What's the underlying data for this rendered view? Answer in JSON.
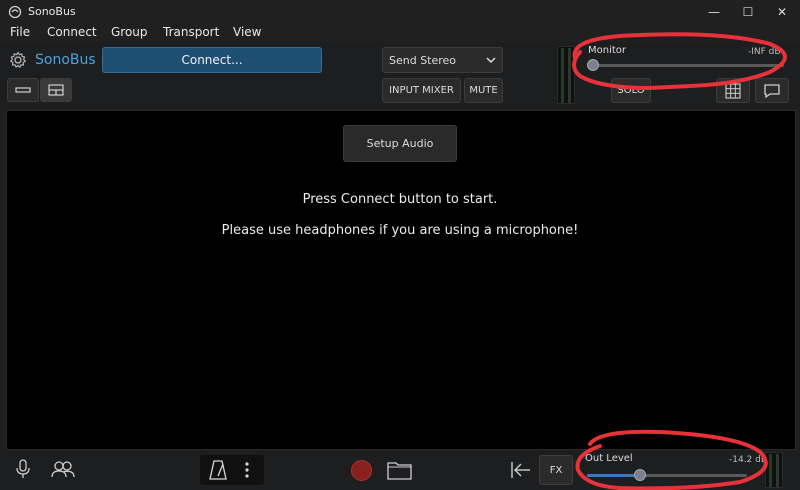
{
  "window": {
    "title": "SonoBus",
    "minimize_glyph": "—",
    "maximize_glyph": "☐",
    "close_glyph": "✕"
  },
  "menu": [
    "File",
    "Connect",
    "Group",
    "Transport",
    "View"
  ],
  "header": {
    "brand": "SonoBus",
    "connect_label": "Connect...",
    "send_mode": "Send Stereo",
    "input_mixer_label": "INPUT MIXER",
    "mute_label": "MUTE",
    "solo_label": "SOLO"
  },
  "monitor": {
    "label": "Monitor",
    "value_text": "-INF dB",
    "level": 0.0
  },
  "main": {
    "setup_audio_label": "Setup Audio",
    "message_1": "Press Connect button to start.",
    "message_2": "Please use headphones if you are using a microphone!"
  },
  "footer": {
    "fx_label": "FX",
    "out_level_label": "Out Level",
    "out_level_value": "-14.2 dB",
    "out_level_fraction": 0.33
  },
  "colors": {
    "accent": "#1f4e73",
    "brand_text": "#4ea3e0",
    "annotation": "#e8323a",
    "record": "#8a1f1f"
  }
}
